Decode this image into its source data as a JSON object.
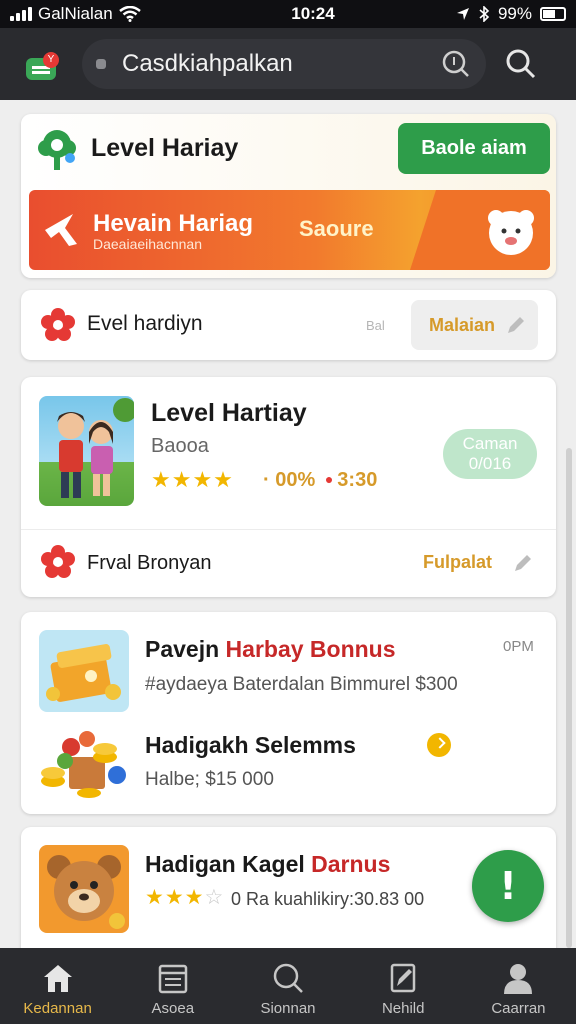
{
  "status_bar": {
    "carrier": "GalNialan",
    "time": "10:24",
    "battery": "99%"
  },
  "app_bar": {
    "title": "Casdkiahpalkan"
  },
  "level_card": {
    "title": "Level Hariay",
    "button_label": "Baole aiam",
    "banner": {
      "title": "Hevain Hariag",
      "subtitle": "Daeaiaeihacnnan",
      "score": "Saoure"
    }
  },
  "level_row": {
    "label": "Evel hardiyn",
    "faint_text": "Bal",
    "action_label": "Malaian"
  },
  "game_card": {
    "title": "Level Hartiay",
    "subtitle": "Baooa",
    "rating": 4,
    "rating_stars": "★★★★",
    "meta_value": "· 00% ",
    "meta_time": "3:30",
    "mint_badge_line1": "Caman",
    "mint_badge_line2": "0/016",
    "footer_label": "Frval Bronyan",
    "footer_action": "Fulpalat"
  },
  "bonus_card": {
    "item1_title_prefix": "Pavejn ",
    "item1_title_highlight": "Harbay Bonnus",
    "item1_time": "0PM",
    "item1_subtitle": "#aydaeya Baterdalan Bimmurel $300",
    "item2_title": "Hadigakh Selemms",
    "item2_subtitle": "Halbe; $15 000"
  },
  "kagel_card": {
    "title_prefix": "Hadigan Kagel ",
    "title_highlight": "Darnus",
    "rating": 3,
    "rating_stars": "★★★",
    "rating_empty": "☆",
    "meta": "0 Ra kuahlikiry:30.83 00",
    "time": "0"
  },
  "fab": {
    "label": "!"
  },
  "bottom_nav": [
    {
      "label": "Kedannan",
      "icon": "home-icon",
      "active": true
    },
    {
      "label": "Asoea",
      "icon": "calendar-icon",
      "active": false
    },
    {
      "label": "Sionnan",
      "icon": "search-icon",
      "active": false
    },
    {
      "label": "Nehild",
      "icon": "edit-icon",
      "active": false
    },
    {
      "label": "Caarran",
      "icon": "profile-icon",
      "active": false
    }
  ],
  "colors": {
    "accent_green": "#2e9d4a",
    "gold": "#f2b600",
    "banner_orange": "#f27a2d",
    "highlight_red": "#c62828"
  }
}
